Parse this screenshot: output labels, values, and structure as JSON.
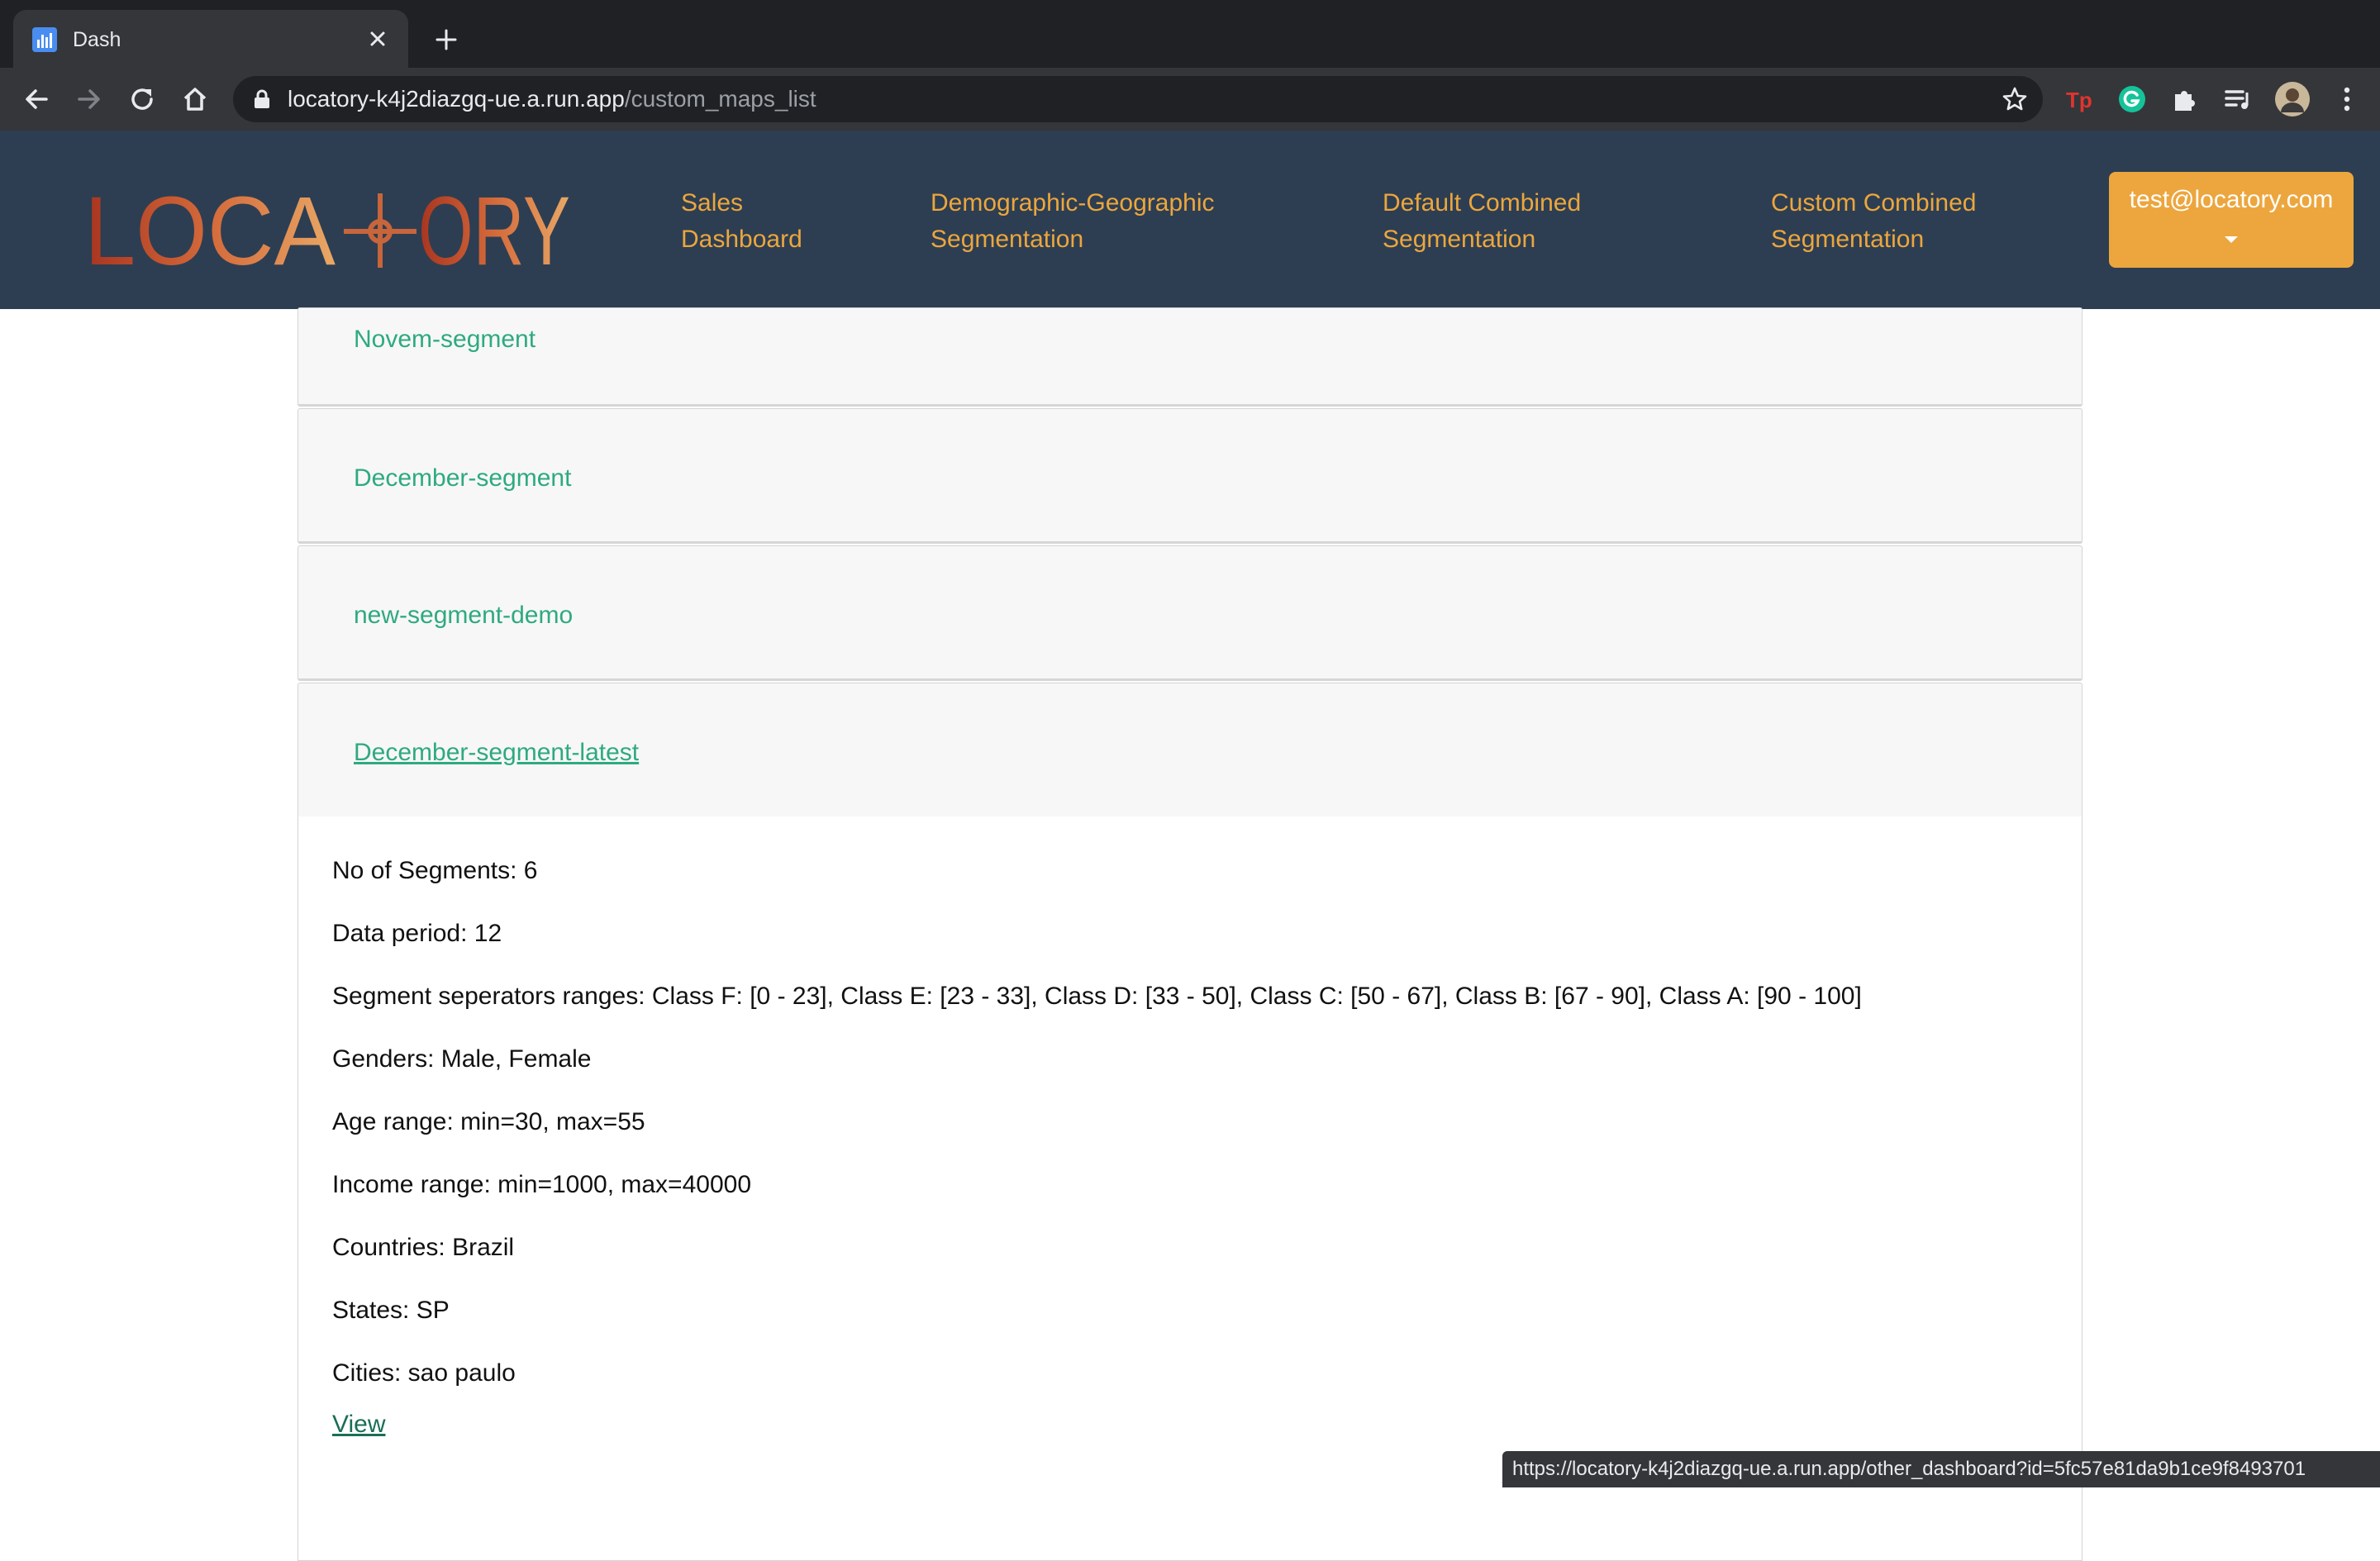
{
  "browser": {
    "tab_title": "Dash",
    "url_host": "locatory-k4j2diazgq-ue.a.run.app",
    "url_path": "/custom_maps_list",
    "status_url": "https://locatory-k4j2diazgq-ue.a.run.app/other_dashboard?id=5fc57e81da9b1ce9f8493701"
  },
  "navbar": {
    "logo_text": "LOCATORY",
    "links": [
      {
        "label": "Sales\nDashboard"
      },
      {
        "label": "Demographic-Geographic\nSegmentation"
      },
      {
        "label": "Default Combined\nSegmentation"
      },
      {
        "label": "Custom Combined\nSegmentation"
      }
    ],
    "user_email": "test@locatory.com"
  },
  "segments": [
    {
      "name": "Novem-segment"
    },
    {
      "name": "December-segment"
    },
    {
      "name": "new-segment-demo"
    },
    {
      "name": "December-segment-latest"
    }
  ],
  "details": {
    "no_of_segments": "No of Segments: 6",
    "data_period": "Data period: 12",
    "separators": "Segment seperators ranges: Class F: [0 - 23], Class E: [23 - 33], Class D: [33 - 50], Class C: [50 - 67], Class B: [67 - 90], Class A: [90 - 100]",
    "genders": "Genders: Male, Female",
    "age_range": "Age range: min=30, max=55",
    "income_range": "Income range: min=1000, max=40000",
    "countries": "Countries: Brazil",
    "states": "States: SP",
    "cities": "Cities: sao paulo",
    "view_label": "View"
  },
  "colors": {
    "navbar_bg": "#2d3e52",
    "accent_orange": "#eca63d",
    "link_green": "#2eaa7f"
  }
}
